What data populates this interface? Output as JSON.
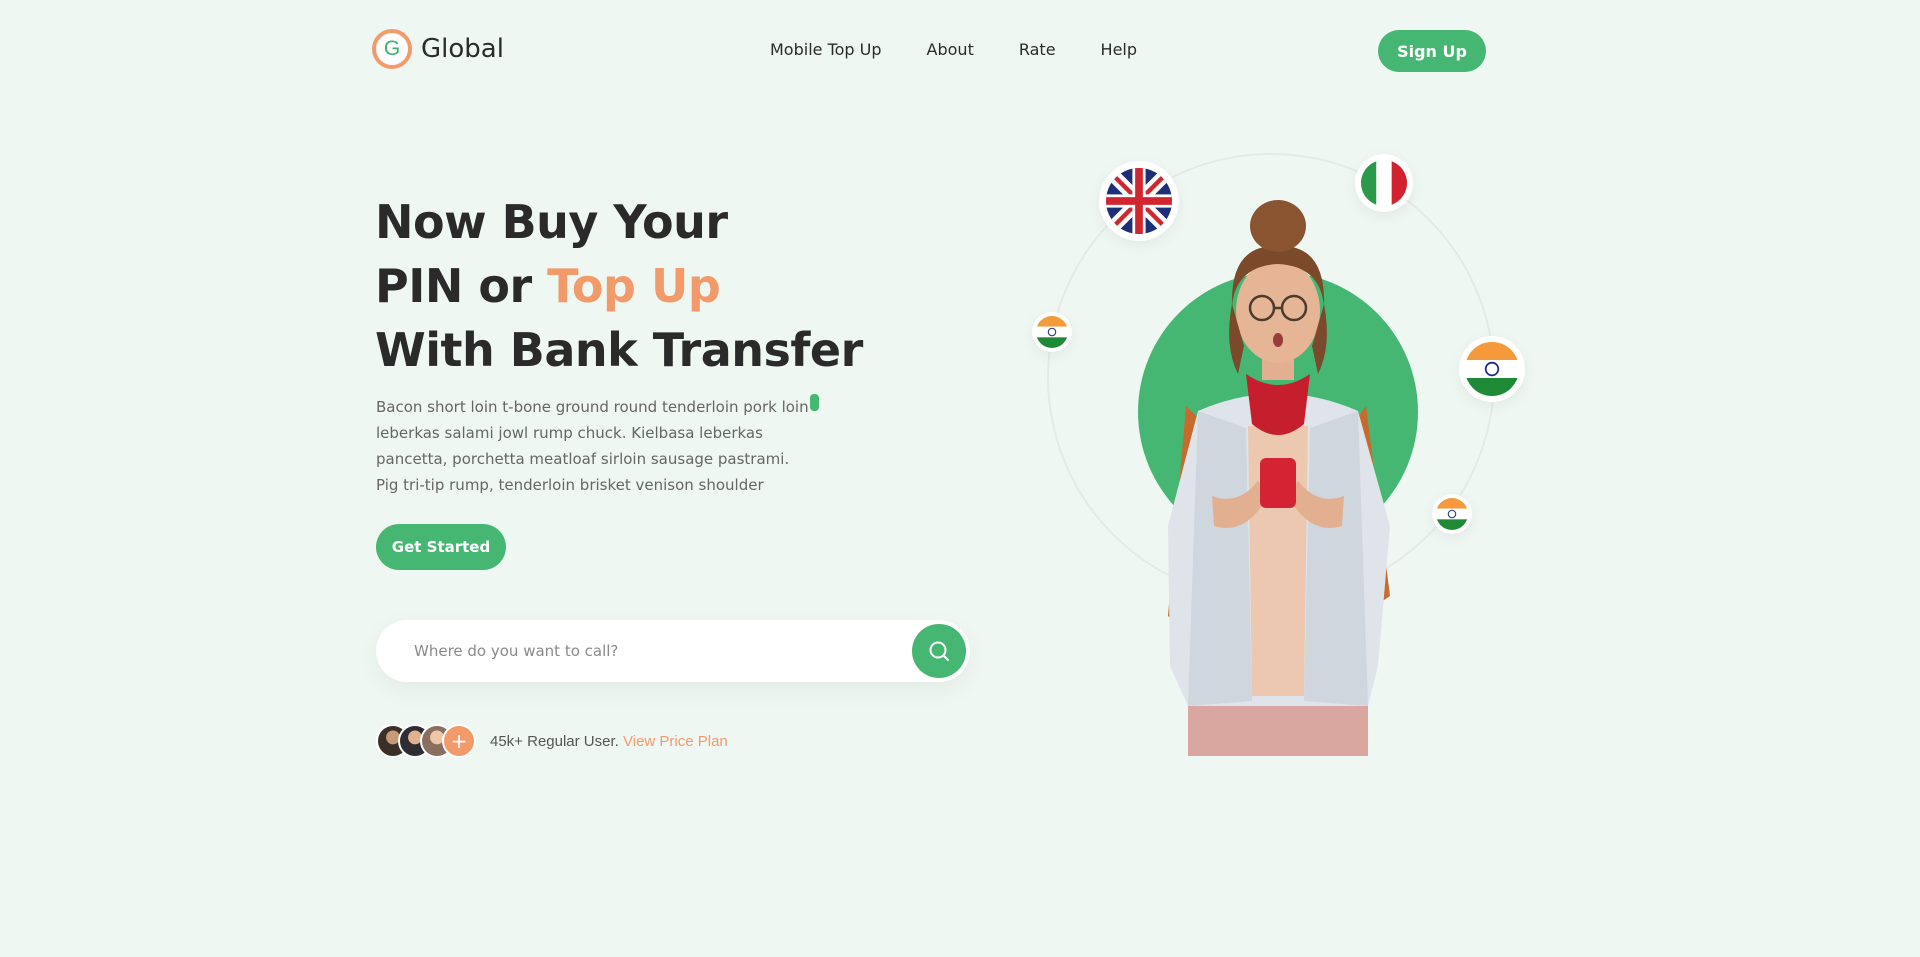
{
  "header": {
    "logo_letter": "G",
    "logo_text": "Global",
    "nav": [
      "Mobile Top Up",
      "About",
      "Rate",
      "Help"
    ],
    "signup_label": "Sign Up"
  },
  "hero": {
    "title_line1": "Now Buy Your",
    "title_line2_a": "PIN or ",
    "title_line2_accent": "Top Up",
    "title_line3": "With Bank Transfer",
    "description": "Bacon short loin t-bone ground round tenderloin pork loin leberkas salami jowl rump chuck. Kielbasa leberkas pancetta, porchetta meatloaf sirloin sausage pastrami. Pig tri-tip rump, tenderloin brisket venison shoulder",
    "cta_label": "Get Started",
    "search_placeholder": "Where do you want to call?",
    "users_text": "45k+ Regular User.",
    "users_link": "View Price Plan",
    "plus_symbol": "+"
  },
  "colors": {
    "background": "#eef7f2",
    "brand_green": "#46b773",
    "accent_orange": "#f39a6b",
    "text_dark": "#2a2a2a"
  },
  "icons": [
    "search-icon",
    "uk-flag-icon",
    "italy-flag-icon",
    "india-flag-icon"
  ]
}
